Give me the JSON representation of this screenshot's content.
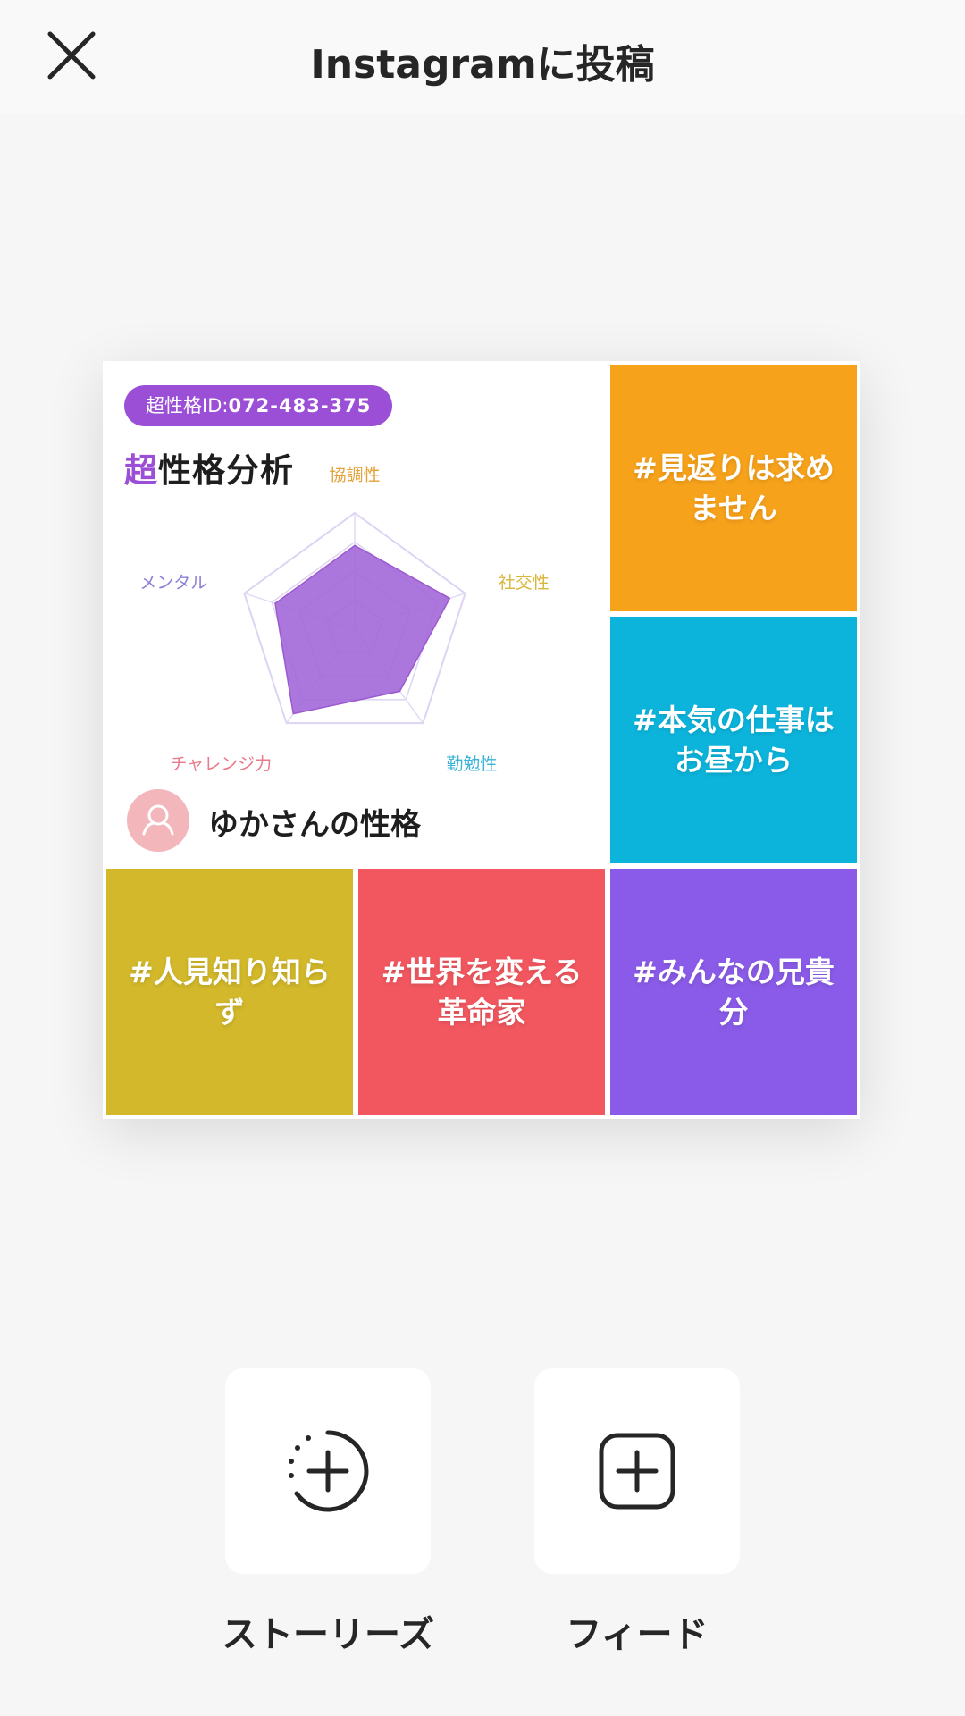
{
  "header": {
    "title": "Instagramに投稿",
    "close_icon": "close-icon"
  },
  "card": {
    "id_badge": {
      "label": "超性格ID:",
      "value": "072-483-375"
    },
    "brand": {
      "highlight": "超",
      "rest": "性格分析"
    },
    "radar": {
      "axes": [
        "協調性",
        "社交性",
        "勤勉性",
        "チャレンジ力",
        "メンタル"
      ],
      "values": [
        0.72,
        0.86,
        0.66,
        0.9,
        0.72
      ],
      "max": 1,
      "fill_color": "#a064d8",
      "axis_colors": [
        "#e3a33a",
        "#d8b73a",
        "#3ab3d8",
        "#e87a8a",
        "#8a7fd6"
      ]
    },
    "user": {
      "avatar_icon": "user-avatar-icon",
      "title": "ゆかさんの性格"
    },
    "tiles": [
      {
        "text": "#見返りは求めません",
        "color": "#f7a21b"
      },
      {
        "text": "#本気の仕事はお昼から",
        "color": "#0cb4dc"
      },
      {
        "text": "#人見知り知らず",
        "color": "#d2b82a"
      },
      {
        "text": "#世界を変える革命家",
        "color": "#f2575f"
      },
      {
        "text": "#みんなの兄貴分",
        "color": "#8a5be8"
      }
    ]
  },
  "share_options": [
    {
      "label": "ストーリーズ",
      "icon": "story-add-icon"
    },
    {
      "label": "フィード",
      "icon": "feed-add-icon"
    }
  ]
}
